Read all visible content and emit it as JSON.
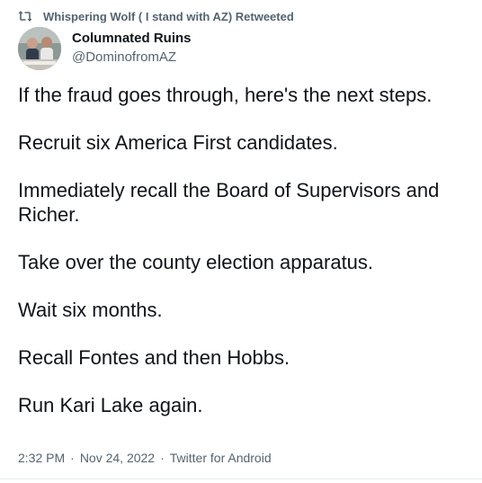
{
  "retweet": {
    "icon": "retweet-icon",
    "text": "Whispering Wolf ( I stand with AZ) Retweeted"
  },
  "author": {
    "name": "Columnated Ruins",
    "handle": "@DominofromAZ",
    "avatar_icon": "avatar-photo"
  },
  "tweet": {
    "paragraphs": [
      "If the fraud goes through, here's the next steps.",
      "Recruit six America First candidates.",
      "Immediately recall the Board of Supervisors and Richer.",
      "Take over the county election apparatus.",
      "Wait six months.",
      "Recall Fontes and then Hobbs.",
      "Run Kari Lake again."
    ]
  },
  "meta": {
    "time": "2:32 PM",
    "separator": "·",
    "date": "Nov 24, 2022",
    "source": "Twitter for Android"
  },
  "colors": {
    "text": "#0f1419",
    "secondary": "#536471"
  }
}
